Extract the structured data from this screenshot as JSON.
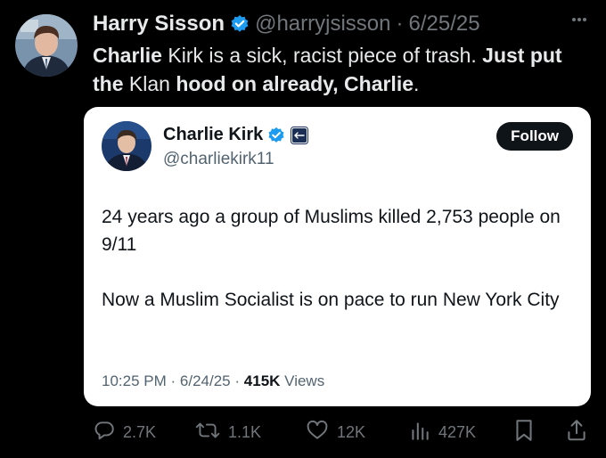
{
  "tweet": {
    "author_name": "Harry Sisson",
    "handle": "@harryjsisson",
    "separator": "·",
    "date": "6/25/25",
    "text_segments": [
      {
        "text": "Charlie",
        "bold": true
      },
      {
        "text": " Kirk is a sick, racist piece of trash. ",
        "bold": false
      },
      {
        "text": "Just put the",
        "bold": true
      },
      {
        "text": " Klan ",
        "bold": false
      },
      {
        "text": "hood on already, Charlie",
        "bold": true
      },
      {
        "text": ".",
        "bold": false
      }
    ]
  },
  "quote": {
    "author_name": "Charlie Kirk",
    "handle": "@charliekirk11",
    "follow_label": "Follow",
    "paragraph1": "24 years ago a group of Muslims killed 2,753 people on 9/11",
    "paragraph2": "Now a Muslim Socialist is on pace to run New York City",
    "time": "10:25 PM",
    "date": "6/24/25",
    "views_count": "415K",
    "views_label": "Views",
    "dot": "·"
  },
  "actions": {
    "replies": "2.7K",
    "reposts": "1.1K",
    "likes": "12K",
    "views": "427K"
  },
  "icons": {
    "more": "more-dots-icon",
    "verified": "verified-badge-icon",
    "reply": "reply-icon",
    "repost": "repost-icon",
    "like": "heart-icon",
    "views": "views-bar-chart-icon",
    "bookmark": "bookmark-icon",
    "share": "share-icon"
  },
  "colors": {
    "background": "#000000",
    "verified_blue": "#1d9bf0",
    "muted_text": "#71767b",
    "quote_card": "#ffffff"
  }
}
